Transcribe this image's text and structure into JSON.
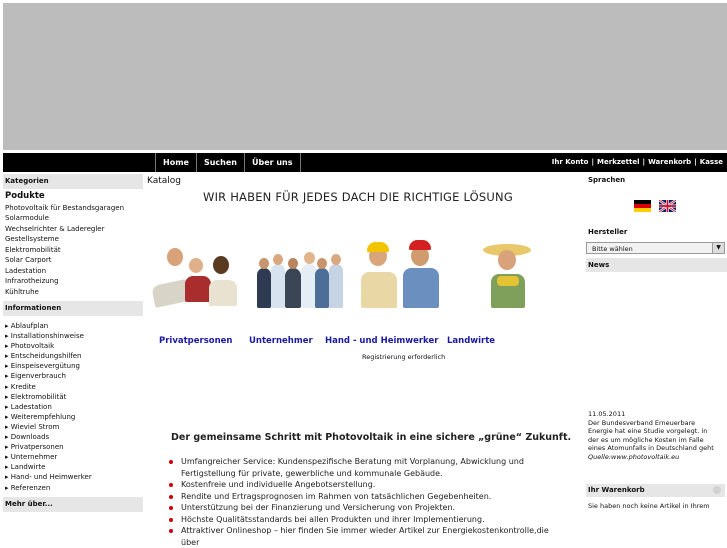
{
  "nav": {
    "left": [
      "Home",
      "Suchen",
      "Über uns"
    ],
    "right": [
      "Ihr Konto",
      "Merkzettel",
      "Warenkorb",
      "Kasse"
    ]
  },
  "left_sidebar": {
    "categories_heading": "Kategorien",
    "products_heading": "Podukte",
    "categories": [
      "Photovoltaik für Bestandsgaragen",
      "Solarmodule",
      "Wechselrichter & Laderegler",
      "Gestellsysteme",
      "Elektromobilität",
      "Solar Carport",
      "Ladestation",
      "Infrarotheizung",
      "Kühltruhe"
    ],
    "info_heading": "Informationen",
    "info_items": [
      "Ablaufplan",
      "Installationshinweise",
      "Photovoltaik",
      "Entscheidungshilfen",
      "Einspeisevergütung",
      "Eigenverbrauch",
      "Kredite",
      "Elektromobilität",
      "Ladestation",
      "Weiterempfehlung",
      "Wieviel Strom",
      "Downloads",
      "Privatpersonen",
      "Unternehmer",
      "Landwirte",
      "Hand- und Heimwerker",
      "Referenzen"
    ],
    "more_heading": "Mehr über..."
  },
  "main": {
    "catalog_label": "Katalog",
    "headline": "WIR HABEN FÜR JEDES DACH DIE RICHTIGE LÖSUNG",
    "category_links": [
      "Privatpersonen",
      "Unternehmer",
      "Hand - und Heimwerker",
      "Landwirte"
    ],
    "registration_note": "Registrierung erforderlich",
    "tagline": "Der gemeinsame Schritt mit Photovoltaik in eine sichere „grüne“ Zukunft.",
    "bullets": [
      "Umfangreicher Service: Kundenspezifische Beratung mit Vorplanung, Abwicklung und",
      "Fertigstellung für private, gewerbliche und kommunale Gebäude.",
      "Kostenfreie und individuelle Angebotserstellung.",
      "Rendite und Ertragsprognosen im Rahmen von tatsächlichen Gegebenheiten.",
      "Unterstützung bei der Finanzierung und Versicherung von Projekten.",
      "Höchste Qualitätsstandards bei allen Produkten und ihrer Implementierung.",
      "Attraktiver Onlineshop – hier finden Sie immer wieder Artikel zur Energiekostenkontrolle,die über"
    ]
  },
  "right_sidebar": {
    "languages_heading": "Sprachen",
    "manufacturer_heading": "Hersteller",
    "manufacturer_select": "Bitte wählen",
    "news_heading": "News",
    "news_date": "11.05.2011",
    "news_text": [
      "Der Bundesverband Erneuerbare",
      "Energie hat eine Studie vorgelegt. in",
      "der es um mögliche Kosten im Falle",
      "eines Atomunfalls in Deutschland geht"
    ],
    "news_source": "Quelle:www.photovoltaik.eu",
    "cart_heading": "Ihr Warenkorb",
    "cart_text": "Sie haben noch keine Artikel in Ihrem"
  },
  "colors": {
    "link": "#1a1aa0",
    "bullet": "#cc0000",
    "nav_bg": "#000000",
    "banner": "#bcbcbc"
  }
}
